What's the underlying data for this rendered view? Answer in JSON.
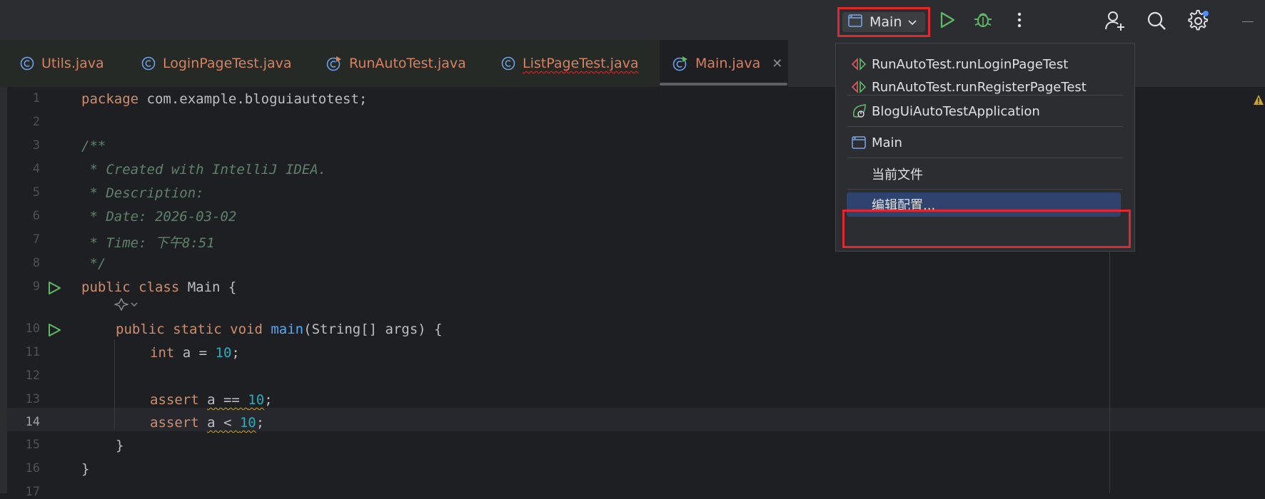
{
  "toolbar": {
    "run_config_label": "Main"
  },
  "tabs": [
    {
      "label": "Utils.java",
      "has_error": false
    },
    {
      "label": "LoginPageTest.java",
      "has_error": false
    },
    {
      "label": "RunAutoTest.java",
      "has_error": false
    },
    {
      "label": "ListPageTest.java",
      "has_error": true
    },
    {
      "label": "Main.java",
      "has_error": false,
      "active": true
    }
  ],
  "editor": {
    "current_line": "14",
    "line_numbers": [
      "1",
      "2",
      "3",
      "4",
      "5",
      "6",
      "7",
      "8",
      "9",
      "",
      "10",
      "11",
      "12",
      "13",
      "14",
      "15",
      "16",
      "17"
    ],
    "lines": {
      "l1_kw": "package",
      "l1_rest": " com.example.bloguiautotest;",
      "l3": "/**",
      "l4": " * Created with IntelliJ IDEA.",
      "l5": " * Description:",
      "l6": " * Date: 2026-03-02",
      "l7": " * Time: 下午8:51",
      "l8": " */",
      "l9_kw": "public class",
      "l9_rest": " Main {",
      "l10_kw": "public static void",
      "l10_fn": "main",
      "l10_rest": "(String[] args) {",
      "l11_kw": "int",
      "l11_mid": " a = ",
      "l11_num": "10",
      "l11_end": ";",
      "l13_kw": "assert",
      "l13_var": "a == ",
      "l13_num": "10",
      "l13_end": ";",
      "l14_kw": "assert",
      "l14_var": "a < ",
      "l14_num": "10",
      "l14_end": ";",
      "l15": "}",
      "l16": "}"
    }
  },
  "run_menu": {
    "items": [
      {
        "label": "RunAutoTest.runLoginPageTest",
        "icon": "junit-test-icon"
      },
      {
        "label": "RunAutoTest.runRegisterPageTest",
        "icon": "junit-test-icon"
      },
      {
        "label": "BlogUiAutoTestApplication",
        "icon": "spring-boot-icon"
      },
      {
        "label": "Main",
        "icon": "application-icon"
      },
      {
        "label": "当前文件",
        "icon": ""
      },
      {
        "label": "编辑配置...",
        "icon": "",
        "selected": true
      }
    ]
  },
  "colors": {
    "highlight_frame": "#e0282e",
    "run_green": "#5fb865",
    "selection_blue": "#2e436e"
  }
}
